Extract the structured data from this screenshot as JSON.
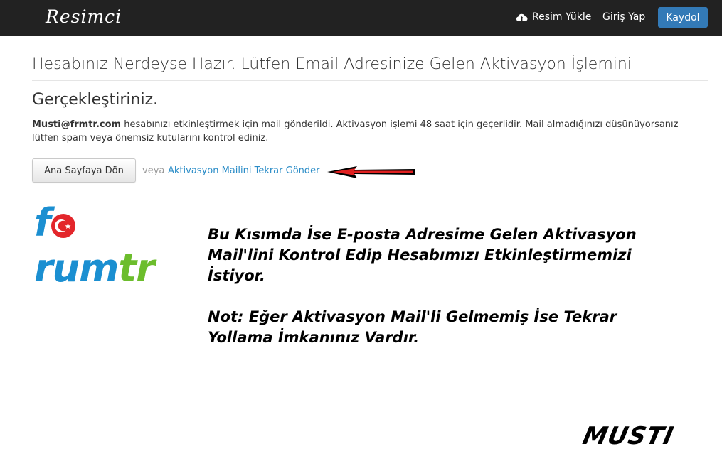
{
  "header": {
    "brand": "Resimci",
    "upload_label": "Resim Yükle",
    "login_label": "Giriş Yap",
    "register_label": "Kaydol"
  },
  "main": {
    "title_line1": "Hesabınız Nerdeyse Hazır. Lütfen Email Adresinize Gelen Aktivasyon İşlemini",
    "title_line2": "Gerçekleştiriniz.",
    "email": "Musti@frmtr.com",
    "message": " hesabınızı etkinleştirmek için mail gönderildi. Aktivasyon işlemi 48 saat için geçerlidir. Mail almadığınızı düşünüyorsanız lütfen spam veya önemsiz kutularını kontrol ediniz.",
    "home_button": "Ana Sayfaya Dön",
    "or_text": "veya",
    "resend_link": "Aktivasyon Mailini Tekrar Gönder"
  },
  "annotation": {
    "logo": {
      "part1": "f",
      "part2": "rum",
      "part3": "tr"
    },
    "note_line1": "Bu Kısımda İse E-posta Adresime Gelen Aktivasyon",
    "note_line2": "Mail'lini Kontrol Edip Hesabımızı Etkinleştirmemizi",
    "note_line3": "İstiyor.",
    "note_line4": "Not: Eğer Aktivasyon Mail'li Gelmemiş İse Tekrar",
    "note_line5": "Yollama İmkanınız Vardır.",
    "signature": "MUSTI"
  },
  "colors": {
    "navbar_bg": "#222222",
    "primary": "#337ab7",
    "link": "#2a8cc7",
    "arrow": "#e02020",
    "logo_blue": "#1b8fd1",
    "logo_green": "#6cbd2c",
    "logo_red": "#e3262b"
  }
}
